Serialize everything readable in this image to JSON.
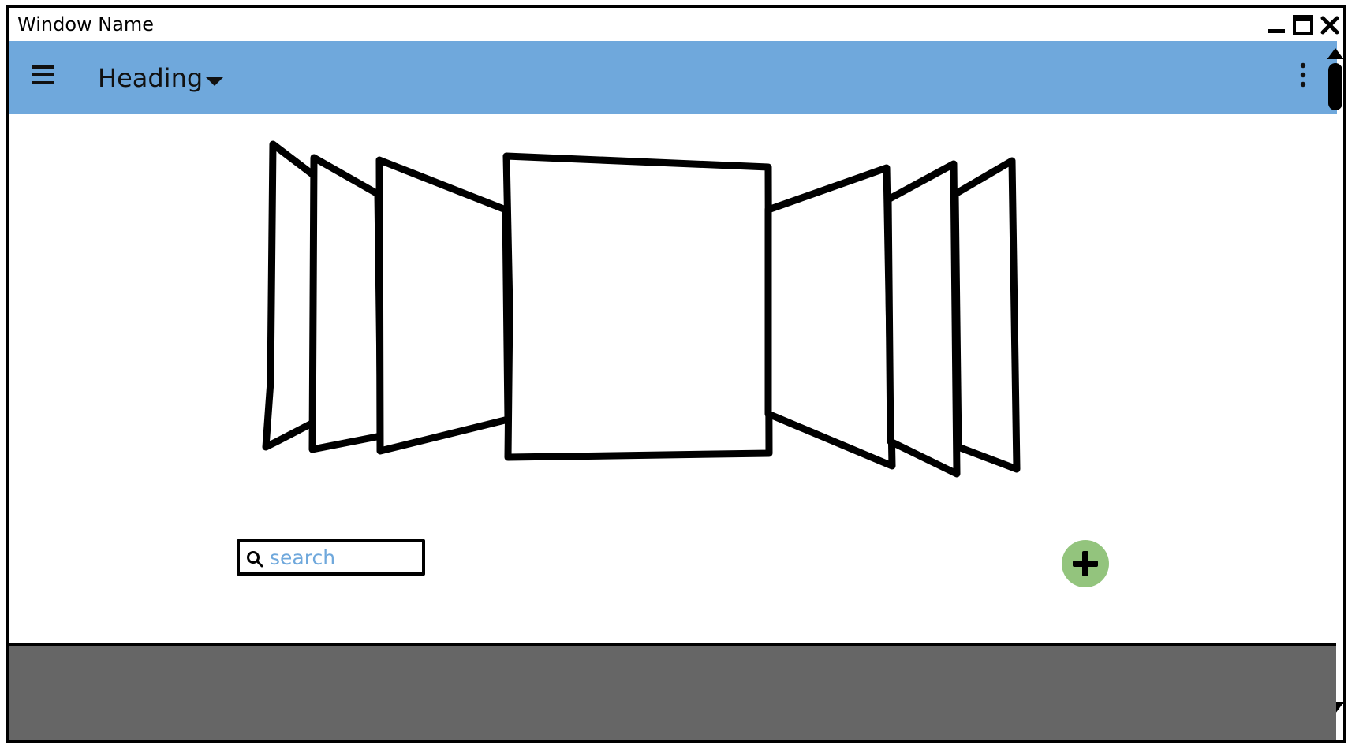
{
  "window": {
    "title": "Window Name",
    "controls": {
      "minimize_icon": "minimize-icon",
      "maximize_icon": "maximize-icon",
      "close_icon": "close-icon"
    }
  },
  "appbar": {
    "menu_icon": "hamburger-menu-icon",
    "heading": "Heading",
    "heading_icon": "chevron-down-icon",
    "more_icon": "more-vertical-icon",
    "background": "#6fa8dc"
  },
  "carousel": {
    "items_count": 7,
    "selected_index": 3
  },
  "search": {
    "placeholder": "search",
    "icon": "search-icon",
    "placeholder_color": "#6fa8dc"
  },
  "actions": {
    "add_icon": "plus-icon",
    "add_color": "#93c47d"
  },
  "footer": {
    "background": "#666666"
  }
}
